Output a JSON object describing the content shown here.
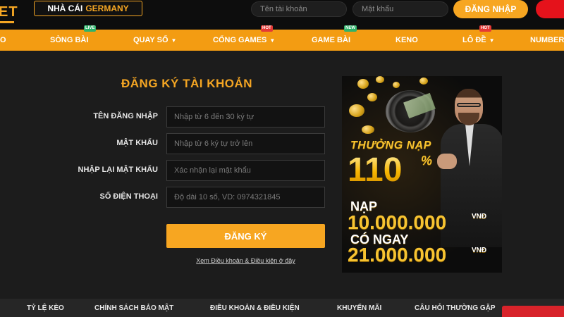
{
  "header": {
    "logo_text": "ET",
    "brand_prefix": "NHÀ CÁI",
    "brand_suffix": "GERMANY",
    "username_placeholder": "Tên tài khoản",
    "password_placeholder": "Mật khẩu",
    "login_label": "ĐĂNG NHẬP"
  },
  "nav": {
    "items": [
      {
        "label": "O"
      },
      {
        "label": "SÒNG BÀI",
        "badge": "LIVE"
      },
      {
        "label": "QUAY SỐ"
      },
      {
        "label": "CỔNG GAMES",
        "badge": "HOT"
      },
      {
        "label": "GAME BÀI",
        "badge": "NEW"
      },
      {
        "label": "KENO"
      },
      {
        "label": "LÔ ĐỀ",
        "badge": "HOT"
      },
      {
        "label": "NUMBER"
      }
    ]
  },
  "form": {
    "title": "ĐĂNG KÝ TÀI KHOẢN",
    "username_label": "TÊN ĐĂNG NHẬP",
    "username_placeholder": "Nhập từ 6 đến 30 ký tự",
    "password_label": "MẬT KHẨU",
    "password_placeholder": "Nhập từ 6 ký tự trở lên",
    "confirm_label": "NHẬP LẠI MẬT KHẨU",
    "confirm_placeholder": "Xác nhận lại mật khẩu",
    "phone_label": "SỐ ĐIỆN THOẠI",
    "phone_placeholder": "Độ dài 10 số, VD: 0974321845",
    "submit_label": "ĐĂNG KÝ",
    "terms_link": "Xem Điều khoản & Điều kiện ở đây"
  },
  "promo": {
    "headline": "THƯỞNG NẠP",
    "percent": "110",
    "percent_sign": "%",
    "deposit_label": "NẠP",
    "deposit_amount": "10.000.000",
    "currency": "VNĐ",
    "receive_label": "CÓ NGAY",
    "receive_amount": "21.000.000"
  },
  "footer": {
    "items": [
      "TỶ LỆ KÈO",
      "CHÍNH SÁCH BẢO MẬT",
      "ĐIỀU KHOẢN & ĐIỀU KIỆN",
      "KHUYẾN MÃI",
      "CÂU HỎI THƯỜNG GẶP"
    ]
  },
  "colors": {
    "accent": "#f5a623",
    "nav_bg": "#f39c12",
    "danger": "#e5121b",
    "page_bg": "#1c1c1c"
  }
}
